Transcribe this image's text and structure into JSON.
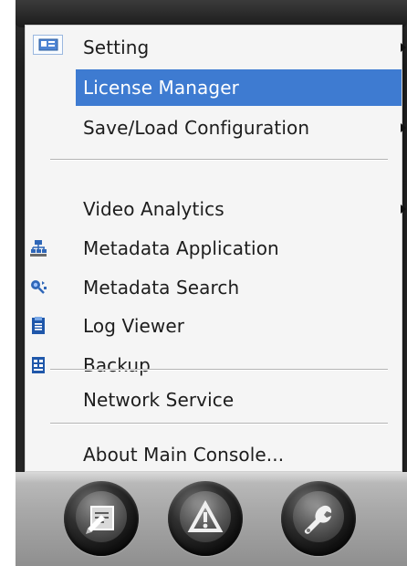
{
  "menu": {
    "items": [
      {
        "label": "Setting",
        "icon": "",
        "has_submenu": true
      },
      {
        "label": "License Manager",
        "icon": "license-card-icon",
        "selected": true
      },
      {
        "label": "Save/Load Configuration",
        "icon": "",
        "has_submenu": true
      },
      {
        "label": "Video Analytics",
        "icon": "",
        "has_submenu": true
      },
      {
        "label": "Metadata Application",
        "icon": "network-hierarchy-icon"
      },
      {
        "label": "Metadata Search",
        "icon": "magnifier-search-icon"
      },
      {
        "label": "Log Viewer",
        "icon": "clipboard-log-icon"
      },
      {
        "label": "Backup",
        "icon": "database-backup-icon"
      },
      {
        "label": "Network Service",
        "icon": ""
      },
      {
        "label": "About Main Console...",
        "icon": ""
      }
    ]
  },
  "colors": {
    "menu_background": "#f5f5f5",
    "selected_background": "#3e7bd1",
    "selected_text": "#ffffff",
    "text": "#1d1d1d",
    "separator": "#b4b4b4",
    "console_dark": "#1f1f1f",
    "console_panel": "#a9a9a9",
    "icon_blue": "#2f67b8"
  },
  "bottom_buttons": [
    {
      "icon": "document-edit-icon"
    },
    {
      "icon": "warning-icon"
    },
    {
      "icon": "wrench-icon"
    }
  ]
}
